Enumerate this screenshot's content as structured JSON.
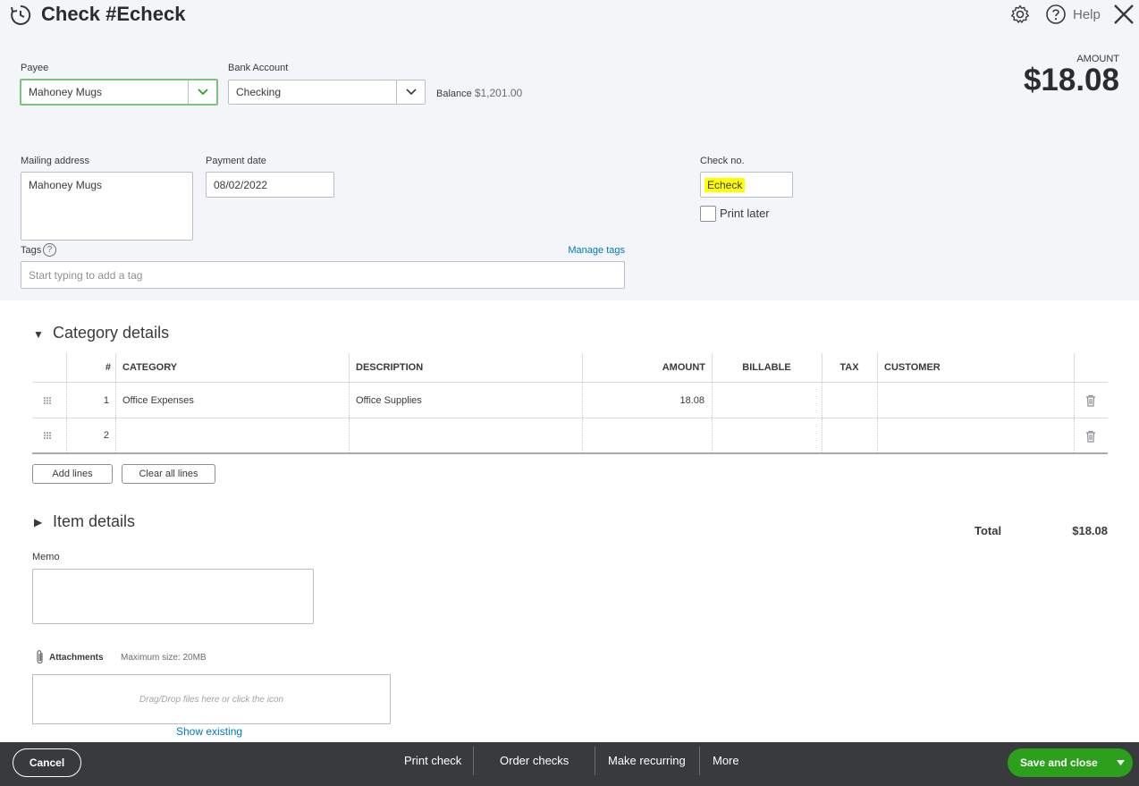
{
  "header": {
    "title": "Check #Echeck",
    "help_label": "Help"
  },
  "payee": {
    "label": "Payee",
    "value": "Mahoney Mugs"
  },
  "bank_account": {
    "label": "Bank Account",
    "value": "Checking"
  },
  "balance": {
    "label": "Balance",
    "value": "$1,201.00"
  },
  "amount": {
    "label": "AMOUNT",
    "value": "$18.08"
  },
  "mailing_address": {
    "label": "Mailing address",
    "value": "Mahoney Mugs"
  },
  "payment_date": {
    "label": "Payment date",
    "value": "08/02/2022"
  },
  "check_no": {
    "label": "Check no.",
    "value": "Echeck"
  },
  "print_later": {
    "label": "Print later",
    "checked": false
  },
  "tags": {
    "label": "Tags",
    "placeholder": "Start typing to add a tag",
    "manage_label": "Manage tags",
    "help_glyph": "?"
  },
  "category_details": {
    "title": "Category details",
    "columns": [
      "#",
      "CATEGORY",
      "DESCRIPTION",
      "AMOUNT",
      "BILLABLE",
      "TAX",
      "CUSTOMER"
    ],
    "rows": [
      {
        "num": "1",
        "category": "Office Expenses",
        "description": "Office Supplies",
        "amount": "18.08"
      },
      {
        "num": "2",
        "category": "",
        "description": "",
        "amount": ""
      }
    ],
    "add_lines_label": "Add lines",
    "clear_lines_label": "Clear all lines"
  },
  "item_details": {
    "title": "Item details"
  },
  "total": {
    "label": "Total",
    "value": "$18.08"
  },
  "memo": {
    "label": "Memo"
  },
  "attachments": {
    "label": "Attachments",
    "max_size": "Maximum size: 20MB",
    "drop_text": "Drag/Drop files here or click the icon",
    "show_existing": "Show existing"
  },
  "footer": {
    "cancel": "Cancel",
    "print_check": "Print check",
    "order_checks": "Order checks",
    "make_recurring": "Make recurring",
    "more": "More",
    "save_close": "Save and close"
  },
  "colors": {
    "accent_green": "#2ca01c",
    "link_blue": "#0077c5",
    "highlight": "#ffff00",
    "footer_bg": "#393a3d"
  }
}
